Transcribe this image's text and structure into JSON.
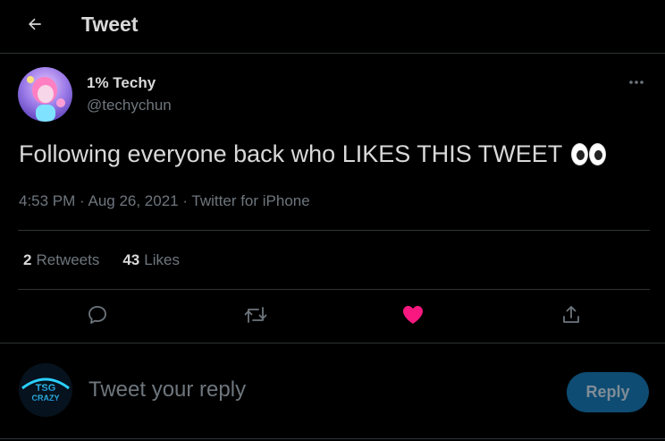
{
  "header": {
    "title": "Tweet",
    "back_icon": "arrow-left-icon"
  },
  "author": {
    "display_name": "1% Techy",
    "handle": "@techychun",
    "more_icon": "more-dots-icon"
  },
  "tweet": {
    "text": "Following everyone back who LIKES THIS TWEET",
    "emoji": "eyes-emoji",
    "meta": "4:53 PM · Aug 26, 2021 · Twitter for iPhone"
  },
  "stats": {
    "retweets_count": "2",
    "retweets_label": "Retweets",
    "likes_count": "43",
    "likes_label": "Likes"
  },
  "actions": {
    "reply_icon": "reply-bubble-icon",
    "retweet_icon": "retweet-icon",
    "like_icon": "heart-icon",
    "share_icon": "share-icon",
    "liked": true,
    "like_color": "#f91880"
  },
  "reply_box": {
    "avatar_text_top": "TSG",
    "avatar_text_bottom": "CRAZY",
    "placeholder": "Tweet your reply",
    "button_label": "Reply"
  },
  "colors": {
    "background": "#000000",
    "accent_disabled": "#0e4c73",
    "secondary_text": "#6e767d"
  }
}
